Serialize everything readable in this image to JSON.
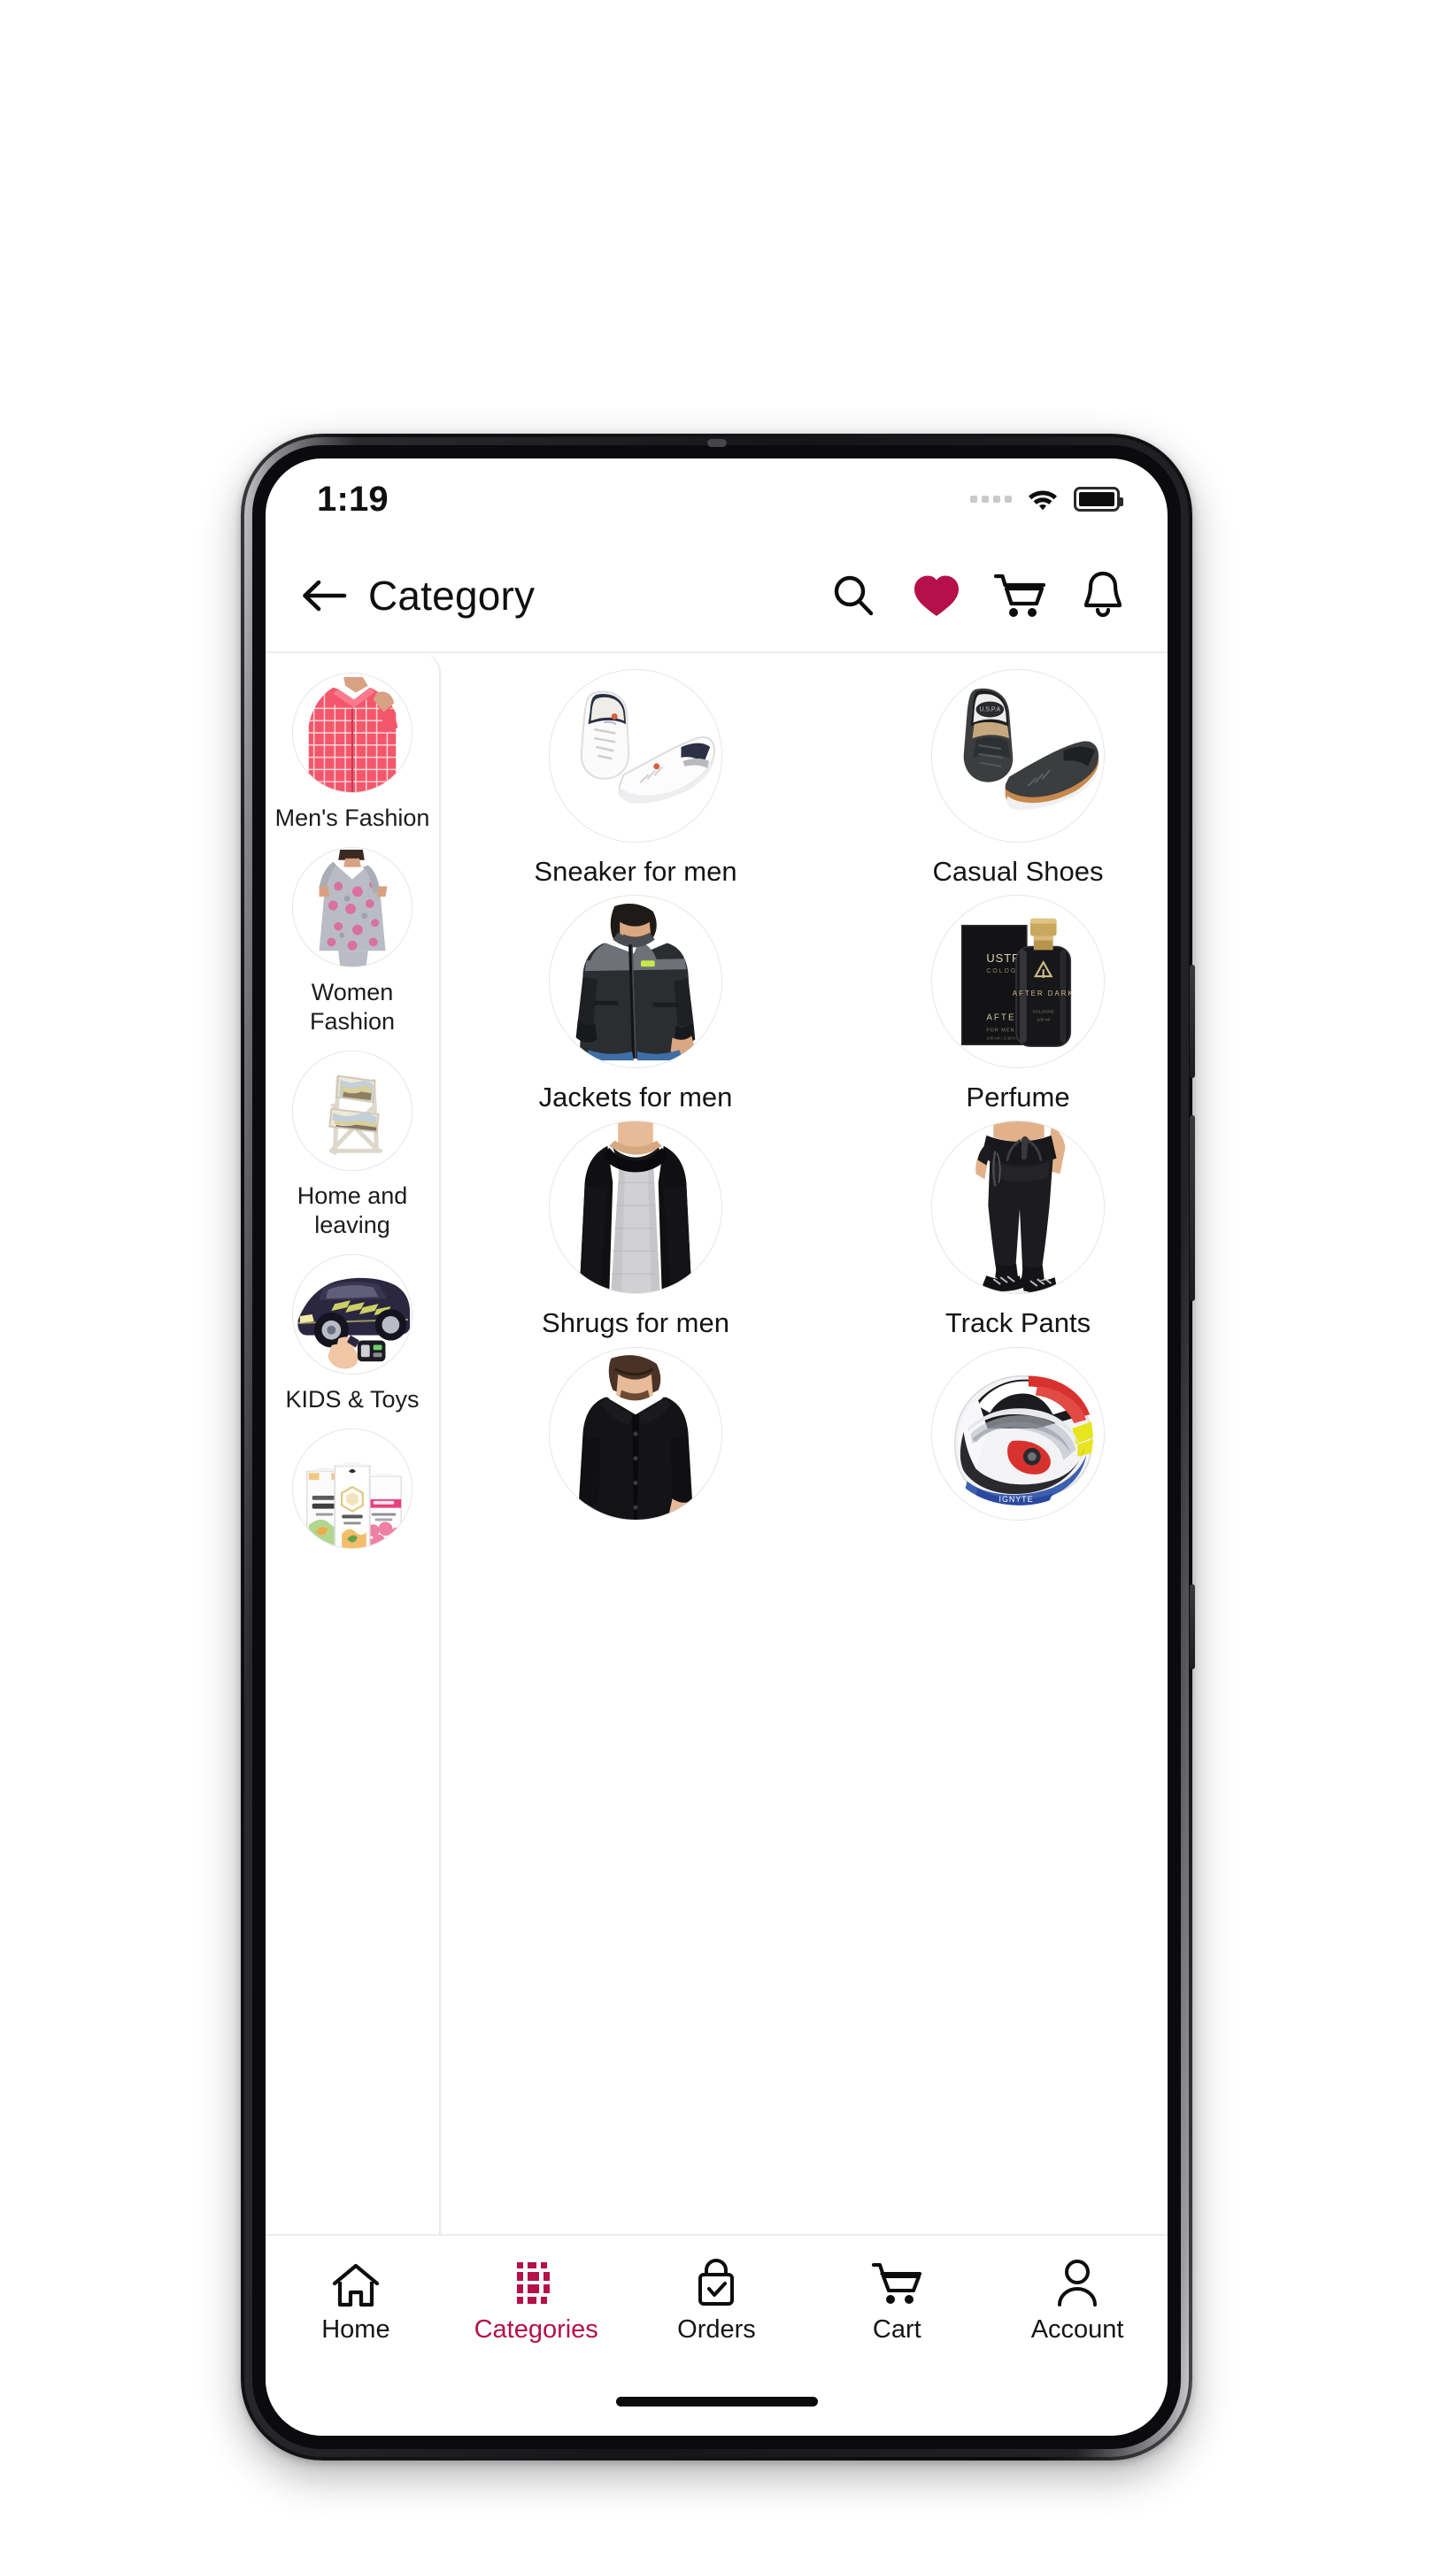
{
  "status_bar": {
    "time": "1:19",
    "icons": [
      "signal-dots",
      "wifi-icon",
      "battery-icon"
    ]
  },
  "app_bar": {
    "back_icon": "back-arrow-icon",
    "title": "Category",
    "actions": [
      {
        "name": "search-icon",
        "label": "Search"
      },
      {
        "name": "wishlist-heart-icon",
        "label": "Wishlist"
      },
      {
        "name": "cart-icon",
        "label": "Cart"
      },
      {
        "name": "notification-bell-icon",
        "label": "Notifications"
      }
    ]
  },
  "sidebar": {
    "items": [
      {
        "label": "Men's Fashion",
        "art": "mens-shirt"
      },
      {
        "label": "Women Fashion",
        "art": "womens-kurti"
      },
      {
        "label": "Home and leaving",
        "art": "folding-chair"
      },
      {
        "label": "KIDS & Toys",
        "art": "toy-car"
      },
      {
        "label": "",
        "art": "beauty-packs"
      }
    ]
  },
  "grid": {
    "items": [
      {
        "label": "Sneaker for men",
        "art": "white-sneakers"
      },
      {
        "label": "Casual Shoes",
        "art": "black-casual-shoes"
      },
      {
        "label": "Jackets for men",
        "art": "grey-black-jacket"
      },
      {
        "label": "Perfume",
        "art": "perfume-bottle-box"
      },
      {
        "label": "Shrugs for men",
        "art": "black-shrug"
      },
      {
        "label": "Track Pants",
        "art": "black-track-pants"
      },
      {
        "label": "",
        "art": "black-shirt"
      },
      {
        "label": "",
        "art": "motorcycle-helmet"
      }
    ]
  },
  "bottom_nav": {
    "active": "Categories",
    "items": [
      {
        "label": "Home",
        "icon": "home-icon"
      },
      {
        "label": "Categories",
        "icon": "grid-dots-icon"
      },
      {
        "label": "Orders",
        "icon": "bag-check-icon"
      },
      {
        "label": "Cart",
        "icon": "cart-icon"
      },
      {
        "label": "Account",
        "icon": "person-icon"
      }
    ]
  },
  "colors": {
    "accent": "#b5104a",
    "text": "#141414",
    "divider": "#e9e9eb",
    "frame": "#141416"
  }
}
